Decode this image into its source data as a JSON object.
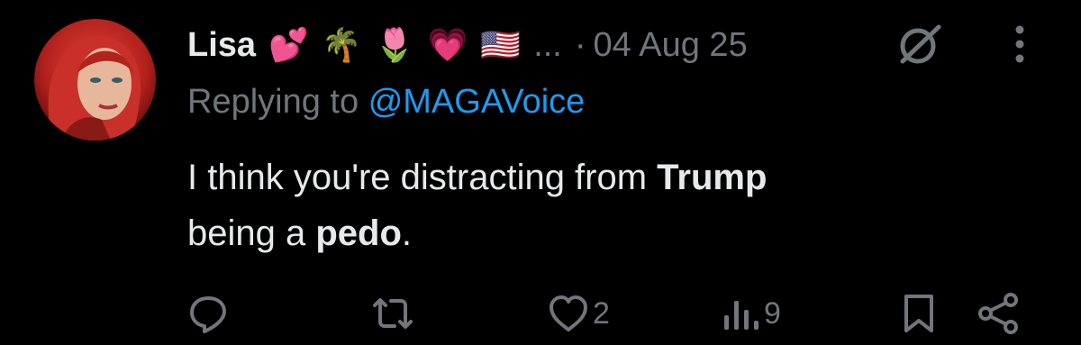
{
  "author": {
    "display_name": "Lisa",
    "name_emojis": [
      "💕",
      "🌴",
      "🌷",
      "💗",
      "🇺🇸"
    ],
    "truncation": "...",
    "separator": "·",
    "date": "04 Aug 25"
  },
  "reply": {
    "prefix": "Replying to",
    "handle": "@MAGAVoice"
  },
  "body": {
    "line1_plain": "I think you're distracting from ",
    "line1_bold": "Trump",
    "line2_plain": "being a ",
    "line2_bold": "pedo",
    "line2_end": "."
  },
  "actions": {
    "reply_icon": "reply-icon",
    "repost_icon": "repost-icon",
    "like_icon": "heart-icon",
    "like_count": "2",
    "views_icon": "views-chart-icon",
    "views_count": "9",
    "bookmark_icon": "bookmark-icon",
    "share_icon": "share-icon"
  },
  "colors": {
    "background": "#000000",
    "text": "#e7e9ea",
    "muted": "#71767b",
    "link": "#1d9bf0"
  }
}
